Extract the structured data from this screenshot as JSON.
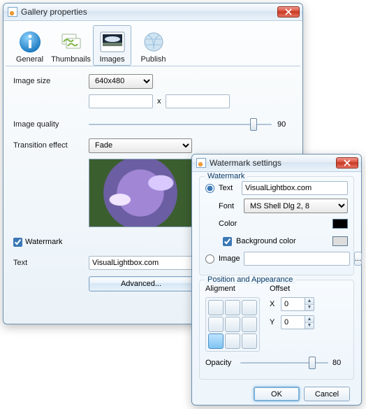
{
  "gallery": {
    "title": "Gallery properties",
    "tabs": {
      "general": "General",
      "thumbnails": "Thumbnails",
      "images": "Images",
      "publish": "Publish"
    },
    "labels": {
      "image_size": "Image size",
      "image_quality": "Image quality",
      "transition_effect": "Transition effect",
      "watermark": "Watermark",
      "text": "Text"
    },
    "image_size_value": "640x480",
    "width_value": "",
    "height_value": "",
    "dim_sep": "x",
    "quality_value": "90",
    "transition_value": "Fade",
    "watermark_checked": true,
    "text_value": "VisualLightbox.com",
    "advanced_btn": "Advanced..."
  },
  "wm": {
    "title": "Watermark settings",
    "group_watermark": "Watermark",
    "group_position": "Position and Appearance",
    "text_radio": "Text",
    "text_value": "VisualLightbox.com",
    "font_label": "Font",
    "font_value": "MS Shell Dlg 2, 8",
    "color_label": "Color",
    "bgcolor_label": "Background color",
    "image_radio": "Image",
    "image_value": "",
    "browse": "...",
    "alignment_label": "Aligment",
    "offset_label": "Offset",
    "x_label": "X",
    "x_value": "0",
    "y_label": "Y",
    "y_value": "0",
    "opacity_label": "Opacity",
    "opacity_value": "80",
    "ok": "OK",
    "cancel": "Cancel"
  }
}
